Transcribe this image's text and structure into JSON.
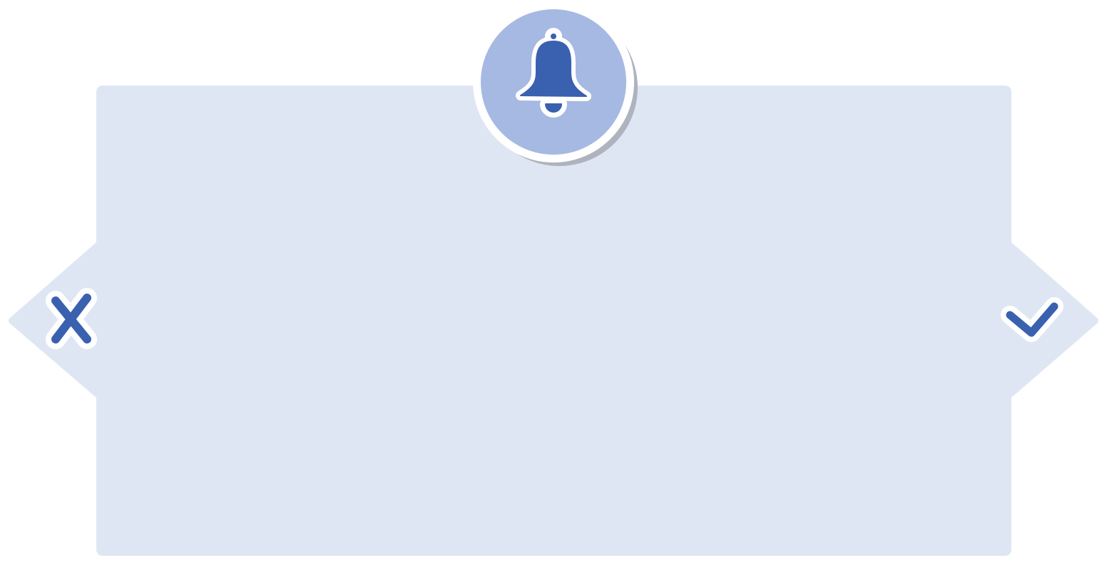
{
  "dialog": {
    "panel_color": "#dfe6f3",
    "badge_fill": "#a5b9e2",
    "badge_shadow": "#aeb3bd",
    "icon_color": "#3a61af",
    "outline_color": "#ffffff",
    "header_icon": "bell-icon",
    "dismiss_icon": "close-icon",
    "confirm_icon": "checkmark-icon"
  }
}
